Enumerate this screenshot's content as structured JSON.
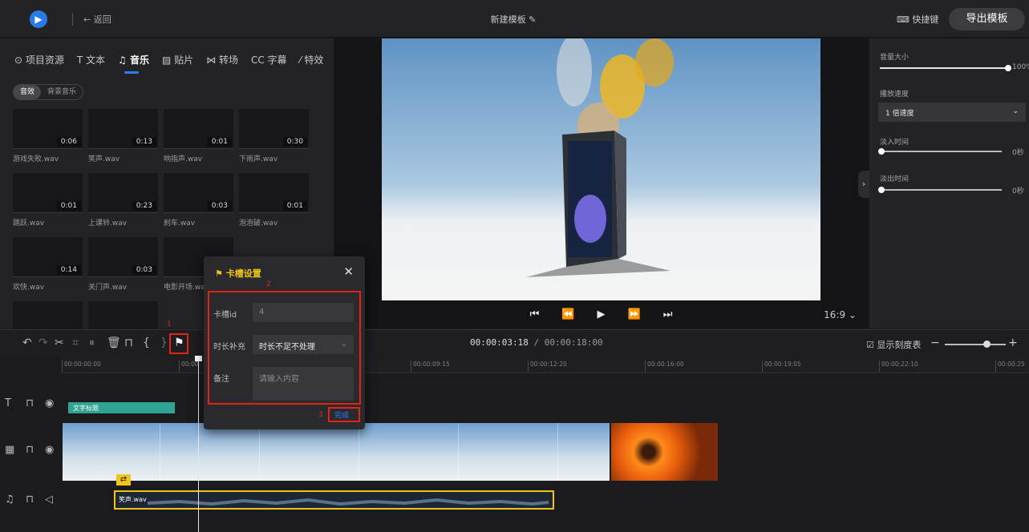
{
  "topbar": {
    "back": "← 返回",
    "title": "新建模板 ✎",
    "shortcut": "⌨ 快捷键",
    "export": "导出模板"
  },
  "tabs": [
    "⊙ 项目资源",
    "T 文本",
    "♫ 音乐",
    "▨ 贴片",
    "⋈ 转场",
    "CC 字幕",
    "⁄ 特效"
  ],
  "subtabs": {
    "effects": "音效",
    "bg": "背景音乐"
  },
  "sounds": [
    {
      "dur": "0:06",
      "name": "游戏失败.wav"
    },
    {
      "dur": "0:13",
      "name": "笑声.wav"
    },
    {
      "dur": "0:01",
      "name": "响指声.wav"
    },
    {
      "dur": "0:30",
      "name": "下雨声.wav"
    },
    {
      "dur": "0:01",
      "name": "跳跃.wav"
    },
    {
      "dur": "0:23",
      "name": "上课铃.wav"
    },
    {
      "dur": "0:03",
      "name": "刹车.wav"
    },
    {
      "dur": "0:01",
      "name": "泡泡破.wav"
    },
    {
      "dur": "0:14",
      "name": "欢快.wav"
    },
    {
      "dur": "0:03",
      "name": "关门声.wav"
    },
    {
      "dur": "",
      "name": "电影开场.wa"
    },
    {
      "dur": "",
      "name": ""
    }
  ],
  "player": {
    "first": "⏮",
    "prev": "⏪",
    "play": "▶",
    "next": "⏩",
    "last": "⏭",
    "ratio": "16:9 ⌄"
  },
  "right": {
    "volume_label": "音量大小",
    "volume_val": "100%",
    "speed_label": "播放速度",
    "speed_value": "1 倍速度",
    "fadein_label": "淡入时间",
    "fadein_val": "0秒",
    "fadeout_label": "淡出时间",
    "fadeout_val": "0秒"
  },
  "toolbar": {
    "current": "00:00:03:18",
    "total": " / 00:00:18:00",
    "show_ruler": "☑ 显示刻度表",
    "marker1": "1"
  },
  "ruler": [
    "00:00:00:00",
    "00:00",
    "00:00:09:15",
    "00:00:12:20",
    "00:00:16:00",
    "00:00:19:05",
    "00:00:22:10",
    "00:00:25"
  ],
  "tracks": {
    "text_clip": "文字标题",
    "audio_clip": "笑声.wav"
  },
  "dialog": {
    "title": "卡槽设置",
    "marker2": "2",
    "id_label": "卡槽id",
    "id_value": "4",
    "dur_label": "时长补充",
    "dur_value": "时长不足不处理",
    "note_label": "备注",
    "note_placeholder": "请输入内容",
    "marker3": "3",
    "done": "完成"
  },
  "colors": {
    "accent": "#2b7fff",
    "highlight": "#e0241a",
    "audio": "#f0c419",
    "text_clip": "#2fa394"
  }
}
